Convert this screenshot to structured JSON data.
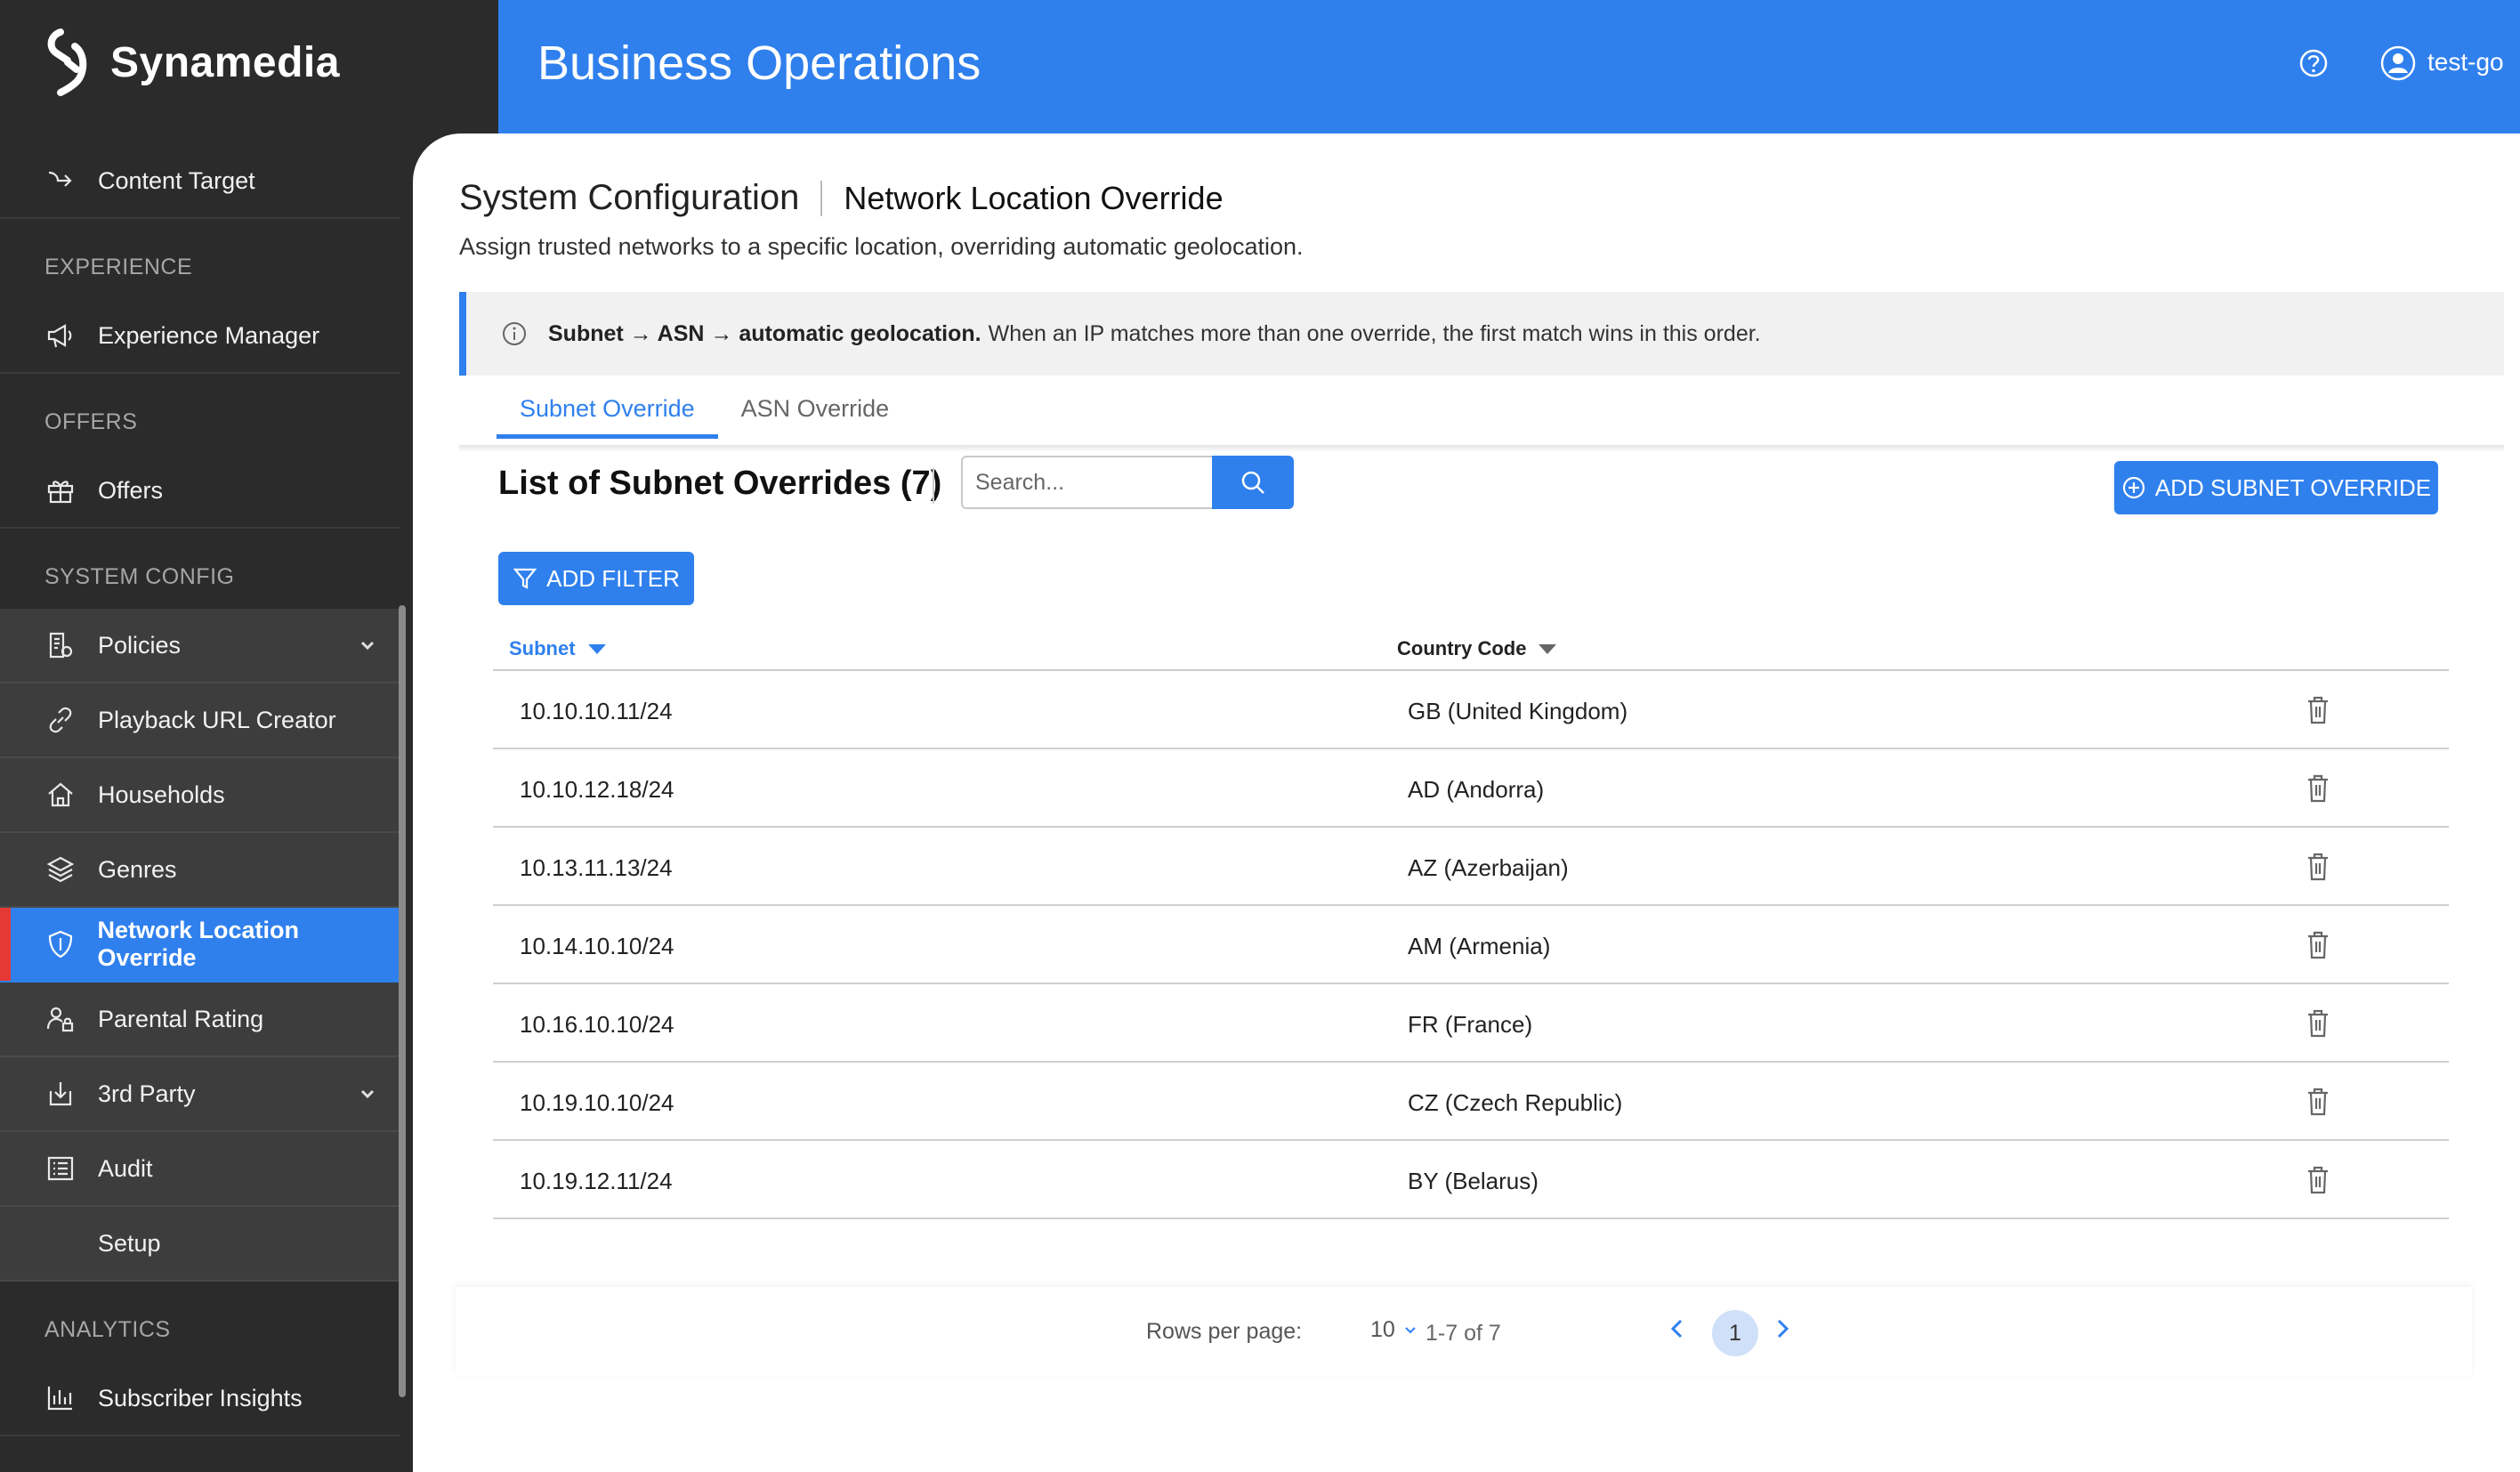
{
  "brand": {
    "name": "Synamedia"
  },
  "header": {
    "title": "Business Operations",
    "user": "test-go"
  },
  "sidebar": {
    "top_item": {
      "label": "Content Target",
      "icon": "arrow-right-icon"
    },
    "sections": [
      {
        "label": "EXPERIENCE",
        "items": [
          {
            "label": "Experience Manager",
            "icon": "megaphone-icon"
          }
        ]
      },
      {
        "label": "OFFERS",
        "items": [
          {
            "label": "Offers",
            "icon": "gift-icon"
          }
        ]
      },
      {
        "label": "SYSTEM CONFIG",
        "items": [
          {
            "label": "Policies",
            "icon": "policy-icon",
            "expandable": true
          },
          {
            "label": "Playback URL Creator",
            "icon": "link-icon"
          },
          {
            "label": "Households",
            "icon": "home-icon"
          },
          {
            "label": "Genres",
            "icon": "layers-icon"
          },
          {
            "label": "Network Location Override",
            "icon": "shield-icon",
            "active": true
          },
          {
            "label": "Parental Rating",
            "icon": "parental-icon"
          },
          {
            "label": "3rd Party",
            "icon": "download-icon",
            "expandable": true
          },
          {
            "label": "Audit",
            "icon": "list-icon"
          },
          {
            "label": "Setup",
            "icon": ""
          }
        ]
      },
      {
        "label": "ANALYTICS",
        "items": [
          {
            "label": "Subscriber Insights",
            "icon": "bar-chart-icon"
          }
        ]
      }
    ]
  },
  "page": {
    "breadcrumb_root": "System Configuration",
    "breadcrumb_current": "Network Location Override",
    "subtitle": "Assign trusted networks to a specific location, overriding automatic geolocation.",
    "info_strong": "Subnet → ASN → automatic geolocation.",
    "info_text": "When an IP matches more than one override, the first match wins in this order.",
    "tabs": [
      {
        "label": "Subnet Override",
        "active": true
      },
      {
        "label": "ASN Override",
        "active": false
      }
    ],
    "list_title": "List of Subnet Overrides (7)",
    "search_placeholder": "Search...",
    "add_button": "ADD SUBNET OVERRIDE",
    "filter_button": "ADD FILTER"
  },
  "table": {
    "columns": [
      "Subnet",
      "Country Code"
    ],
    "rows": [
      {
        "subnet": "10.10.10.11/24",
        "country": "GB (United Kingdom)"
      },
      {
        "subnet": "10.10.12.18/24",
        "country": "AD (Andorra)"
      },
      {
        "subnet": "10.13.11.13/24",
        "country": "AZ (Azerbaijan)"
      },
      {
        "subnet": "10.14.10.10/24",
        "country": "AM (Armenia)"
      },
      {
        "subnet": "10.16.10.10/24",
        "country": "FR (France)"
      },
      {
        "subnet": "10.19.10.10/24",
        "country": "CZ (Czech Republic)"
      },
      {
        "subnet": "10.19.12.11/24",
        "country": "BY (Belarus)"
      }
    ]
  },
  "pagination": {
    "rows_per_page_label": "Rows per page:",
    "rows_per_page": "10",
    "range": "1-7 of 7",
    "current_page": "1"
  },
  "colors": {
    "accent": "#2f80ed",
    "sidebar_bg": "#2b2b2b",
    "active_marker": "#e53935"
  }
}
